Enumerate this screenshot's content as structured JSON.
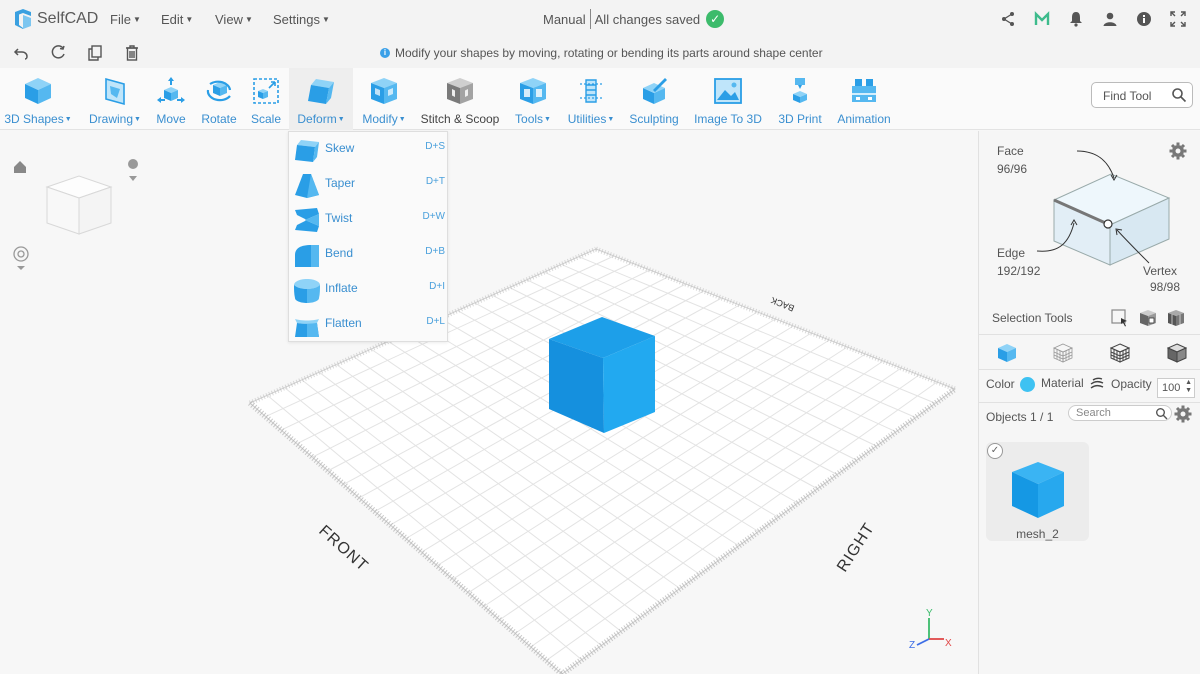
{
  "app": {
    "name": "SelfCAD",
    "menus": [
      "File",
      "Edit",
      "View",
      "Settings"
    ],
    "mode": "Manual",
    "save_status": "All changes saved"
  },
  "hint": "Modify your shapes by moving, rotating or bending its parts around shape center",
  "toolbar": [
    {
      "label": "3D Shapes",
      "dropdown": true,
      "icon": "cube-icon"
    },
    {
      "label": "Drawing",
      "dropdown": true,
      "icon": "drawing-icon"
    },
    {
      "label": "Move",
      "dropdown": false,
      "icon": "move-icon"
    },
    {
      "label": "Rotate",
      "dropdown": false,
      "icon": "rotate-icon"
    },
    {
      "label": "Scale",
      "dropdown": false,
      "icon": "scale-icon"
    },
    {
      "label": "Deform",
      "dropdown": true,
      "icon": "deform-icon"
    },
    {
      "label": "Modify",
      "dropdown": true,
      "icon": "modify-icon"
    },
    {
      "label": "Stitch & Scoop",
      "dropdown": false,
      "icon": "stitch-icon"
    },
    {
      "label": "Tools",
      "dropdown": true,
      "icon": "tools-icon"
    },
    {
      "label": "Utilities",
      "dropdown": true,
      "icon": "utilities-icon"
    },
    {
      "label": "Sculpting",
      "dropdown": false,
      "icon": "sculpting-icon"
    },
    {
      "label": "Image To 3D",
      "dropdown": false,
      "icon": "image-icon"
    },
    {
      "label": "3D Print",
      "dropdown": false,
      "icon": "print-icon"
    },
    {
      "label": "Animation",
      "dropdown": false,
      "icon": "animation-icon"
    }
  ],
  "find_tool": "Find Tool",
  "deform_menu": [
    {
      "label": "Skew",
      "shortcut": "D+S"
    },
    {
      "label": "Taper",
      "shortcut": "D+T"
    },
    {
      "label": "Twist",
      "shortcut": "D+W"
    },
    {
      "label": "Bend",
      "shortcut": "D+B"
    },
    {
      "label": "Inflate",
      "shortcut": "D+I"
    },
    {
      "label": "Flatten",
      "shortcut": "D+L"
    }
  ],
  "viewport": {
    "labels": {
      "front": "FRONT",
      "right": "RIGHT",
      "back": "BACK"
    },
    "axes": {
      "x": "X",
      "y": "Y",
      "z": "Z"
    },
    "cube_color": "#1aa0ec"
  },
  "selection": {
    "face_label": "Face",
    "face_count": "96/96",
    "edge_label": "Edge",
    "edge_count": "192/192",
    "vertex_label": "Vertex",
    "vertex_count": "98/98",
    "tools_label": "Selection Tools"
  },
  "properties": {
    "color_label": "Color",
    "color_value": "#3ec2f2",
    "material_label": "Material",
    "opacity_label": "Opacity",
    "opacity_value": "100"
  },
  "objects": {
    "header": "Objects 1 / 1",
    "search_placeholder": "Search",
    "items": [
      {
        "name": "mesh_2"
      }
    ]
  },
  "colors": {
    "accent": "#3a8fd0",
    "success": "#3cbb6b"
  }
}
